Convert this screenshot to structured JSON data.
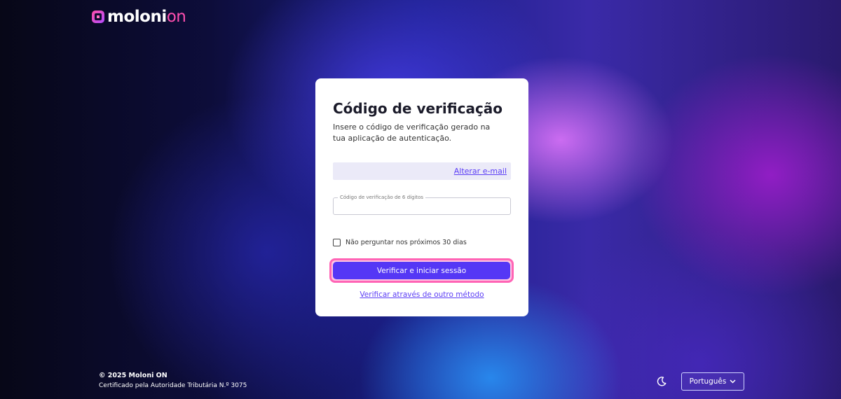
{
  "brand": {
    "logo_main": "moloni",
    "logo_accent": "on",
    "logo_icon": "moloni-logo-icon"
  },
  "card": {
    "title": "Código de verificação",
    "subtitle": "Insere o código de verificação gerado na tua aplicação de autenticação.",
    "change_email_link": "Alterar e-mail",
    "code_field": {
      "label": "Código de verificação de 6 dígitos",
      "value": "",
      "placeholder": ""
    },
    "remember_checkbox": {
      "label": "Não perguntar nos próximos 30 dias",
      "checked": false
    },
    "submit_button": "Verificar e iniciar sessão",
    "alt_method_link": "Verificar através de outro método"
  },
  "footer": {
    "copyright": "© 2025 Moloni ON",
    "certification": "Certificado pela Autoridade Tributária N.º 3075",
    "theme_toggle_icon": "moon-icon",
    "language_selected": "Português",
    "language_icon": "chevron-down-icon"
  },
  "colors": {
    "primary": "#5537f5",
    "focus_ring": "#ff64b5",
    "link": "#5b3df5",
    "brand_accent": "#ff4fb0"
  }
}
